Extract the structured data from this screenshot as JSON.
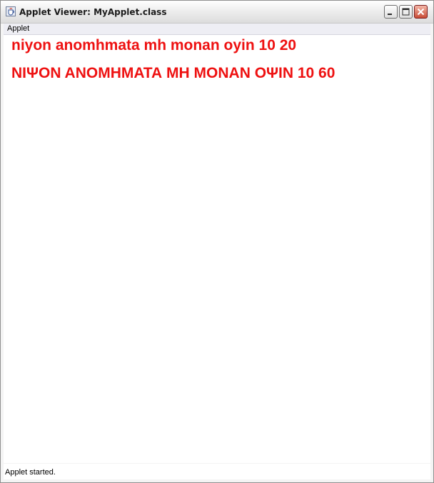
{
  "window": {
    "title": "Applet Viewer: MyApplet.class",
    "icon": "java-cup-icon",
    "controls": {
      "minimize_icon": "minimize-icon",
      "maximize_icon": "maximize-icon",
      "close_icon": "close-icon"
    }
  },
  "menubar": {
    "items": [
      {
        "label": "Applet"
      }
    ]
  },
  "applet": {
    "text_color": "#ee1111",
    "lines": [
      "niyon anomhmata mh monan oyin 10 20",
      "ΝΙΨΟΝ ΑΝΟΜΗΜΑΤΑ ΜΗ ΜΟΝΑΝ ΟΨΙΝ 10 60"
    ]
  },
  "status": {
    "text": "Applet started."
  }
}
